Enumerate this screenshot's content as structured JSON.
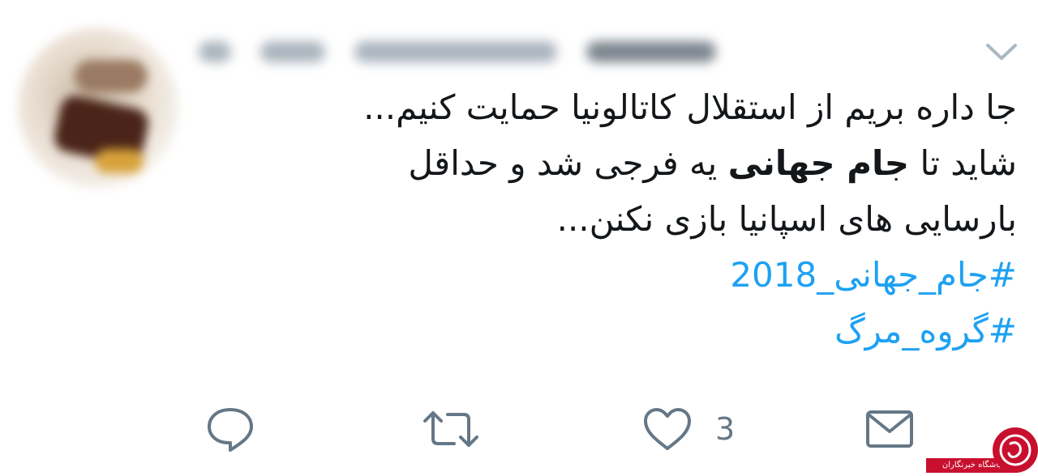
{
  "tweet": {
    "lines": [
      "جا داره بریم از استقلال کاتالونیا حمایت کنیم...",
      "شاید تا",
      "جام جهانی",
      "یه فرجی شد و حداقل",
      "بارسایی های اسپانیا بازی نکنن..."
    ],
    "hashtags": [
      "#جام_جهانی_2018",
      "#گروه_مرگ"
    ]
  },
  "actions": {
    "reply_icon": "reply-icon",
    "retweet_icon": "retweet-icon",
    "like_icon": "heart-icon",
    "like_count": "3",
    "dm_icon": "envelope-icon"
  },
  "watermark": {
    "text": "باشگاه خبرنگاران"
  },
  "colors": {
    "text": "#14171a",
    "hashtag": "#1da1f2",
    "icon": "#657786",
    "watermark": "#c8102e"
  }
}
